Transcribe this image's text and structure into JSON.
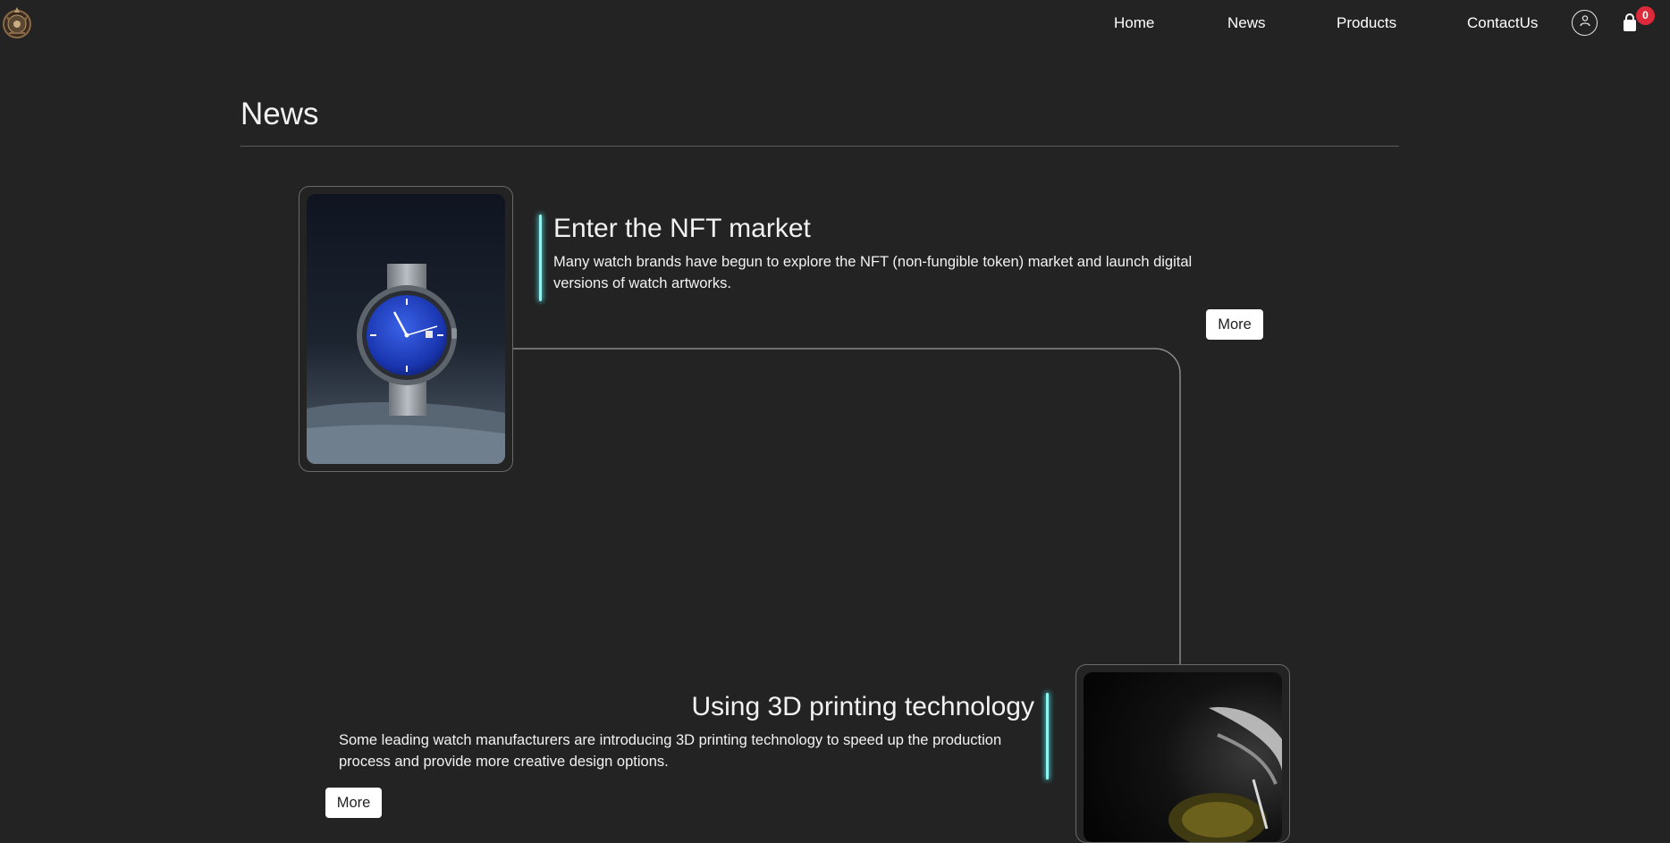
{
  "nav": {
    "links": [
      "Home",
      "News",
      "Products",
      "ContactUs"
    ],
    "cart_count": "0",
    "icons": {
      "logo": "emblem-logo-icon",
      "account": "user-icon",
      "cart": "shopping-bag-icon"
    }
  },
  "page": {
    "title": "News"
  },
  "news": [
    {
      "title": "Enter the NFT market",
      "description": "Many watch brands have begun to explore the NFT (non-fungible token) market and launch digital versions of watch artworks.",
      "more_label": "More"
    },
    {
      "title": "Using 3D printing technology",
      "description": "Some leading watch manufacturers are introducing 3D printing technology to speed up the production process and provide more creative design options.",
      "more_label": "More"
    }
  ],
  "colors": {
    "background": "#232323",
    "accent_glow": "#8ff4f4",
    "badge": "#dd2a3b"
  }
}
